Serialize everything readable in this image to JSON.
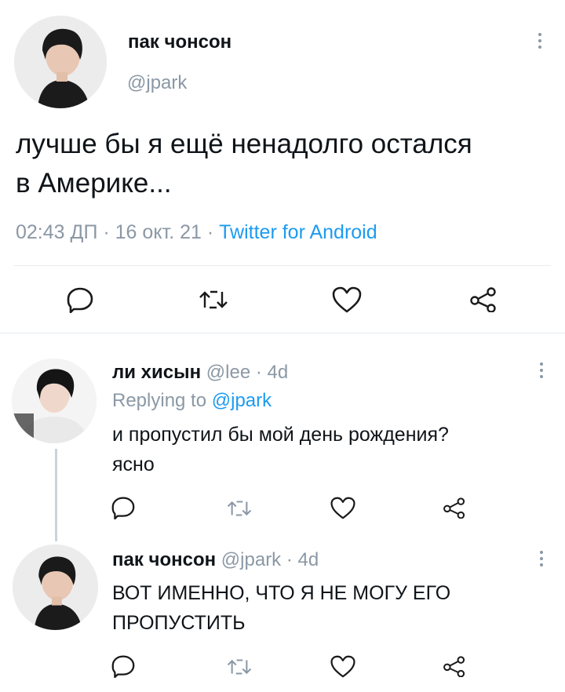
{
  "main_tweet": {
    "display_name": "пак чонсон",
    "handle": "@jpark",
    "text_line1": "лучше бы я ещё ненадолго остался",
    "text_line2": "в Америке...",
    "time": "02:43 ДП",
    "date": "16 окт. 21",
    "client": "Twitter for Android",
    "sep": "·"
  },
  "reply1": {
    "display_name": "ли хисын",
    "handle": "@lee",
    "age": "4d",
    "sep": "·",
    "replying_prefix": "Replying to",
    "replying_handle": "@jpark",
    "text_line1": "и пропустил бы мой день рождения?",
    "text_line2": "ясно"
  },
  "reply2": {
    "display_name": "пак чонсон",
    "handle": "@jpark",
    "age": "4d",
    "sep": "·",
    "text_line1": "ВОТ ИМЕННО, ЧТО Я НЕ МОГУ ЕГО",
    "text_line2": "ПРОПУСТИТЬ"
  },
  "icons": [
    "more-icon",
    "reply-icon",
    "retweet-icon",
    "like-icon",
    "share-icon"
  ],
  "colors": {
    "text": "#0f1419",
    "muted": "#8b98a5",
    "link": "#1d9bf0",
    "divider": "#e6ecf0"
  }
}
